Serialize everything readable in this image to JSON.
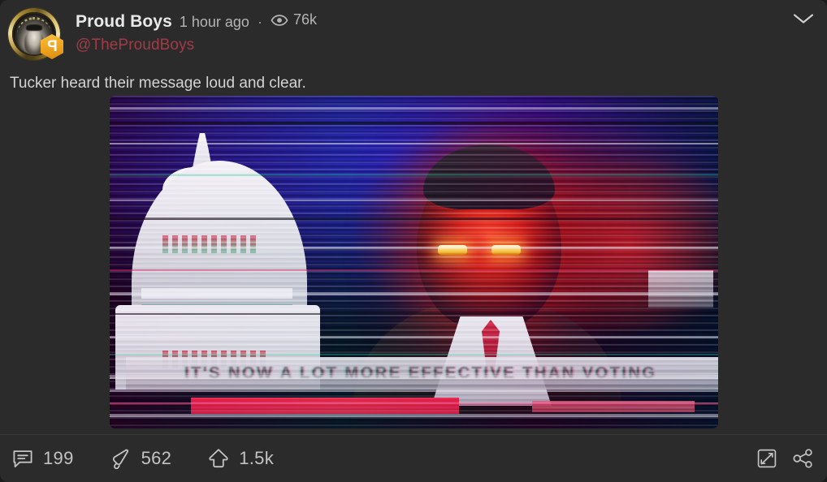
{
  "post": {
    "author": {
      "display_name": "Proud Boys",
      "handle": "@TheProudBoys",
      "avatar_alt": "proud-boys-medallion-avatar",
      "badge_glyph": "P",
      "badge_alt": "parler-verified-hex-badge"
    },
    "meta": {
      "timestamp": "1 hour ago",
      "separator": "·",
      "views_icon": "eye-icon",
      "views": "76k"
    },
    "body_text": "Tucker heard their message loud and clear.",
    "menu_icon": "chevron-down-icon",
    "media": {
      "type": "glitched-video-still",
      "alt": "distorted broadcast still: US Capitol dome at left, red-lit news anchor with glowing eyes at right",
      "lower_third_text": "IT'S NOW A LOT MORE EFFECTIVE THAN VOTING",
      "background_color": "#0d0640",
      "glow_color": "#cd161e",
      "eye_color": "#ffd34a"
    },
    "actions": [
      {
        "icon": "comment-icon",
        "name": "comment",
        "count": "199"
      },
      {
        "icon": "echo-icon",
        "name": "echo",
        "count": "562"
      },
      {
        "icon": "upvote-icon",
        "name": "upvote",
        "count": "1.5k"
      }
    ],
    "footer_right": [
      {
        "icon": "expand-icon",
        "name": "expand"
      },
      {
        "icon": "share-icon",
        "name": "share"
      }
    ]
  },
  "theme": {
    "card_background": "#2b2b2b",
    "text_primary": "#e9e9e9",
    "text_secondary": "#b4b4b4",
    "handle_color": "#a23b45",
    "badge_color": "#f0a621",
    "icon_color": "#c3c3c3"
  }
}
